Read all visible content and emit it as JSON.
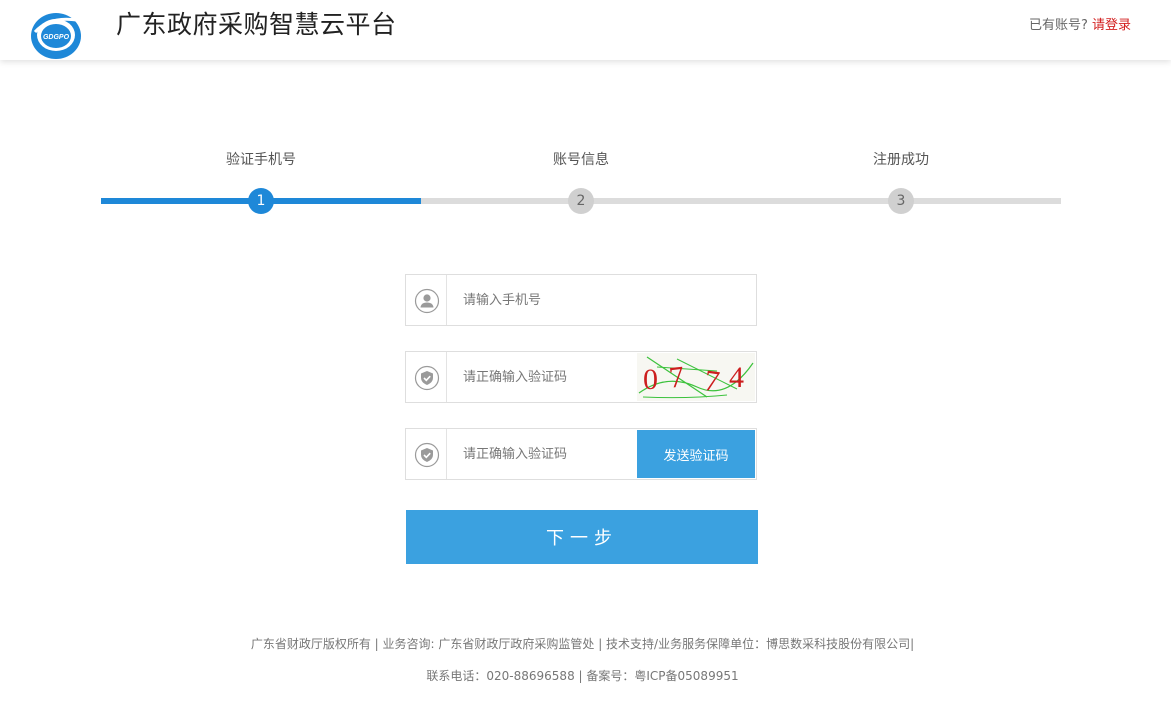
{
  "header": {
    "logo_text": "GDGPO",
    "title": "广东政府采购智慧云平台",
    "account_prompt": "已有账号?",
    "login_link": "请登录"
  },
  "steps": [
    {
      "number": "1",
      "label": "验证手机号",
      "active": true
    },
    {
      "number": "2",
      "label": "账号信息",
      "active": false
    },
    {
      "number": "3",
      "label": "注册成功",
      "active": false
    }
  ],
  "form": {
    "phone": {
      "placeholder": "请输入手机号",
      "value": "",
      "icon": "user-icon"
    },
    "captcha": {
      "placeholder": "请正确输入验证码",
      "value": "",
      "icon": "shield-check-icon",
      "image_text": "0774"
    },
    "sms_code": {
      "placeholder": "请正确输入验证码",
      "value": "",
      "icon": "shield-check-icon"
    },
    "send_code_label": "发送验证码",
    "next_label": "下一步"
  },
  "footer": {
    "line1": "广东省财政厅版权所有 | 业务咨询: 广东省财政厅政府采购监管处 | 技术支持/业务服务保障单位：博思数采科技股份有限公司|",
    "line2": "联系电话：020-88696588 |   备案号：粤ICP备05089951"
  },
  "colors": {
    "accent": "#1e88d8",
    "button": "#3ba1e0",
    "login_link": "#d32020",
    "step_inactive": "#dcdcdc"
  }
}
